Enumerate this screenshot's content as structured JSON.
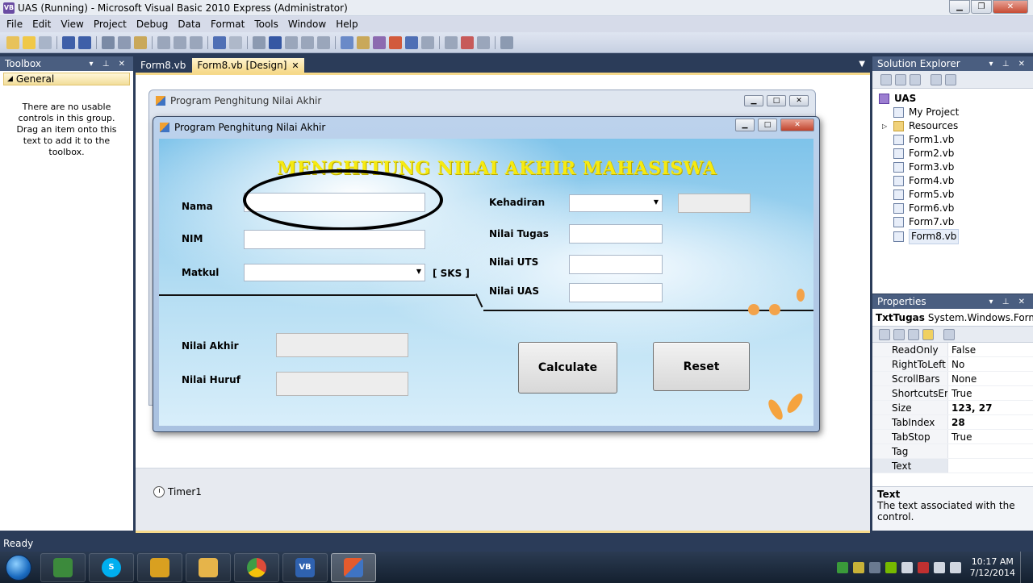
{
  "window": {
    "title": "UAS (Running) - Microsoft Visual Basic 2010 Express (Administrator)",
    "app_icon": "VB"
  },
  "menu": [
    "File",
    "Edit",
    "View",
    "Project",
    "Debug",
    "Data",
    "Format",
    "Tools",
    "Window",
    "Help"
  ],
  "toolbox": {
    "title": "Toolbox",
    "group": "General",
    "empty_message": "There are no usable controls in this group. Drag an item onto this text to add it to the toolbox."
  },
  "tabs": [
    {
      "label": "Form8.vb",
      "active": false
    },
    {
      "label": "Form8.vb [Design]",
      "active": true
    }
  ],
  "back_form_title": "Program Penghitung Nilai Akhir",
  "form": {
    "title": "Program Penghitung Nilai Akhir",
    "heading": "MENGHITUNG NILAI AKHIR MAHASISWA",
    "labels": {
      "nama": "Nama",
      "nim": "NIM",
      "matkul": "Matkul",
      "sks": "[ SKS ]",
      "kehadiran": "Kehadiran",
      "nilai_tugas": "Nilai Tugas",
      "nilai_uts": "Nilai UTS",
      "nilai_uas": "Nilai UAS",
      "nilai_akhir": "Nilai Akhir",
      "nilai_huruf": "Nilai Huruf"
    },
    "values": {
      "nama": "",
      "nim": "",
      "matkul": "",
      "kehadiran": "",
      "kehadiran_score": "",
      "nilai_tugas": "",
      "nilai_uts": "",
      "nilai_uas": "",
      "nilai_akhir": "",
      "nilai_huruf": ""
    },
    "buttons": {
      "calculate": "Calculate",
      "reset": "Reset"
    }
  },
  "component_tray": {
    "timer": "Timer1"
  },
  "solution_explorer": {
    "title": "Solution Explorer",
    "project": "UAS",
    "items": [
      "My Project",
      "Resources",
      "Form1.vb",
      "Form2.vb",
      "Form3.vb",
      "Form4.vb",
      "Form5.vb",
      "Form6.vb",
      "Form7.vb",
      "Form8.vb"
    ],
    "selected": "Form8.vb"
  },
  "properties": {
    "title": "Properties",
    "object_name": "TxtTugas",
    "object_type": "System.Windows.Forms",
    "rows": [
      {
        "name": "ReadOnly",
        "value": "False"
      },
      {
        "name": "RightToLeft",
        "value": "No"
      },
      {
        "name": "ScrollBars",
        "value": "None"
      },
      {
        "name": "ShortcutsEnal",
        "value": "True"
      },
      {
        "name": "Size",
        "value": "123, 27"
      },
      {
        "name": "TabIndex",
        "value": "28"
      },
      {
        "name": "TabStop",
        "value": "True"
      },
      {
        "name": "Tag",
        "value": ""
      },
      {
        "name": "Text",
        "value": ""
      }
    ],
    "desc_title": "Text",
    "desc_text": "The text associated with the control."
  },
  "status": "Ready",
  "taskbar": {
    "clock_time": "10:17 AM",
    "clock_date": "7/12/2014",
    "apps": [
      {
        "icon": "terminal-icon",
        "color": "#3c8a3c"
      },
      {
        "icon": "skype-icon",
        "color": "#00aff0"
      },
      {
        "icon": "winamp-icon",
        "color": "#d9a020"
      },
      {
        "icon": "explorer-icon",
        "color": "#e6b44a"
      },
      {
        "icon": "chrome-icon",
        "color": "#dd4b39"
      },
      {
        "icon": "visual-basic-icon",
        "color": "#2f62b0"
      },
      {
        "icon": "running-form-icon",
        "color": "#e55b2d"
      }
    ]
  },
  "colors": {
    "heading": "#f6ea10",
    "accent_tab": "#f6d98a",
    "chrome": "#2b3c59"
  }
}
